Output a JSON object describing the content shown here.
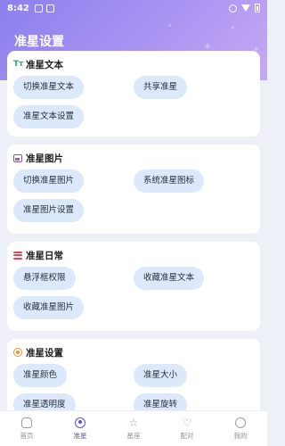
{
  "status_bar": {
    "time": "8:42"
  },
  "header": {
    "title": "准星设置"
  },
  "sections": [
    {
      "title": "准星文本",
      "icon": "text-icon",
      "buttons": [
        "切换准星文本",
        "共享准星",
        "准星文本设置"
      ]
    },
    {
      "title": "准星图片",
      "icon": "image-icon",
      "buttons": [
        "切换准星图片",
        "系统准星图标",
        "准星图片设置"
      ]
    },
    {
      "title": "准星日常",
      "icon": "list-icon",
      "buttons": [
        "悬浮框权限",
        "收藏准星文本",
        "收藏准星图片"
      ]
    },
    {
      "title": "准星设置",
      "icon": "target-icon",
      "buttons": [
        "准星颜色",
        "准星大小",
        "准星透明度",
        "准星旋转"
      ]
    }
  ],
  "tabbar": {
    "tabs": [
      {
        "label": "首页",
        "icon": "home-icon"
      },
      {
        "label": "准星",
        "icon": "crosshair-icon",
        "active": true
      },
      {
        "label": "星座",
        "icon": "star-icon"
      },
      {
        "label": "配对",
        "icon": "heart-icon"
      },
      {
        "label": "我的",
        "icon": "profile-icon"
      }
    ]
  },
  "colors": {
    "accent": "#5b55d6",
    "button_bg": "#dbe9fb",
    "header_gradient_start": "#8b80ee",
    "header_gradient_end": "#c6a9f4"
  }
}
